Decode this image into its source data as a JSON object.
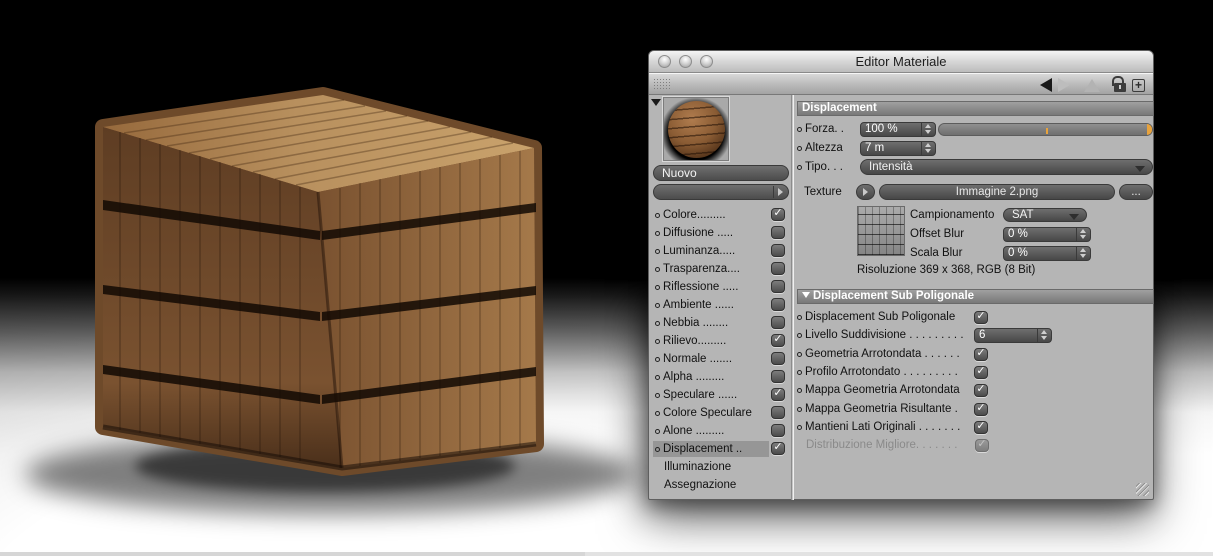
{
  "window": {
    "title": "Editor Materiale",
    "toolbar_icons": [
      "back-icon",
      "forward-icon",
      "pyramid-icon",
      "unlock-icon",
      "add-icon"
    ]
  },
  "sidebar": {
    "material_name": "Nuovo",
    "channels": [
      {
        "label": "Colore.........",
        "checkbox": "checked"
      },
      {
        "label": "Diffusione .....",
        "checkbox": "unchecked"
      },
      {
        "label": "Luminanza.....",
        "checkbox": "unchecked"
      },
      {
        "label": "Trasparenza....",
        "checkbox": "unchecked"
      },
      {
        "label": "Riflessione .....",
        "checkbox": "unchecked"
      },
      {
        "label": "Ambiente ......",
        "checkbox": "unchecked"
      },
      {
        "label": "Nebbia ........",
        "checkbox": "unchecked"
      },
      {
        "label": "Rilievo.........",
        "checkbox": "checked"
      },
      {
        "label": "Normale .......",
        "checkbox": "unchecked"
      },
      {
        "label": "Alpha .........",
        "checkbox": "unchecked"
      },
      {
        "label": "Speculare ......",
        "checkbox": "checked"
      },
      {
        "label": "Colore Speculare",
        "checkbox": "unchecked"
      },
      {
        "label": "Alone .........",
        "checkbox": "unchecked"
      },
      {
        "label": "Displacement ..",
        "checkbox": "checked",
        "selected": true
      },
      {
        "label": "Illuminazione",
        "checkbox": "none"
      },
      {
        "label": "Assegnazione",
        "checkbox": "none"
      }
    ]
  },
  "panel": {
    "header": "Displacement",
    "forza_label": "Forza. .",
    "forza_value": "100 %",
    "altezza_label": "Altezza",
    "altezza_value": "7 m",
    "tipo_label": "Tipo. . .",
    "tipo_value": "Intensità",
    "texture_label": "Texture",
    "texture_file": "Immagine 2.png",
    "browse_label": "...",
    "campionamento_label": "Campionamento",
    "campionamento_value": "SAT",
    "offset_blur_label": "Offset Blur",
    "offset_blur_value": "0 %",
    "scala_blur_label": "Scala Blur",
    "scala_blur_value": "0 %",
    "risoluzione": "Risoluzione 369 x 368, RGB (8 Bit)",
    "sub_header": "Displacement Sub Poligonale",
    "sub_rows": [
      {
        "label": "Displacement Sub Poligonale",
        "type": "check",
        "checked": true
      },
      {
        "label": "Livello Suddivisione . . . . . . . . .",
        "type": "spinner",
        "value": "6"
      },
      {
        "label": "Geometria Arrotondata . . . . . .",
        "type": "check",
        "checked": true
      },
      {
        "label": "Profilo Arrotondato . . . . . . . . .",
        "type": "check",
        "checked": true
      },
      {
        "label": "Mappa Geometria Arrotondata",
        "type": "check",
        "checked": true
      },
      {
        "label": "Mappa Geometria Risultante .",
        "type": "check",
        "checked": true
      },
      {
        "label": "Mantieni Lati Originali . . . . . . .",
        "type": "check",
        "checked": true
      },
      {
        "label": "Distribuzione Migliore. . . . . . .",
        "type": "check",
        "checked": true,
        "disabled": true
      }
    ]
  },
  "colors": {
    "accent_orange": "#e8a33d",
    "panel_gray": "#b5b5b5",
    "field_dark": "#4c4c4c"
  }
}
